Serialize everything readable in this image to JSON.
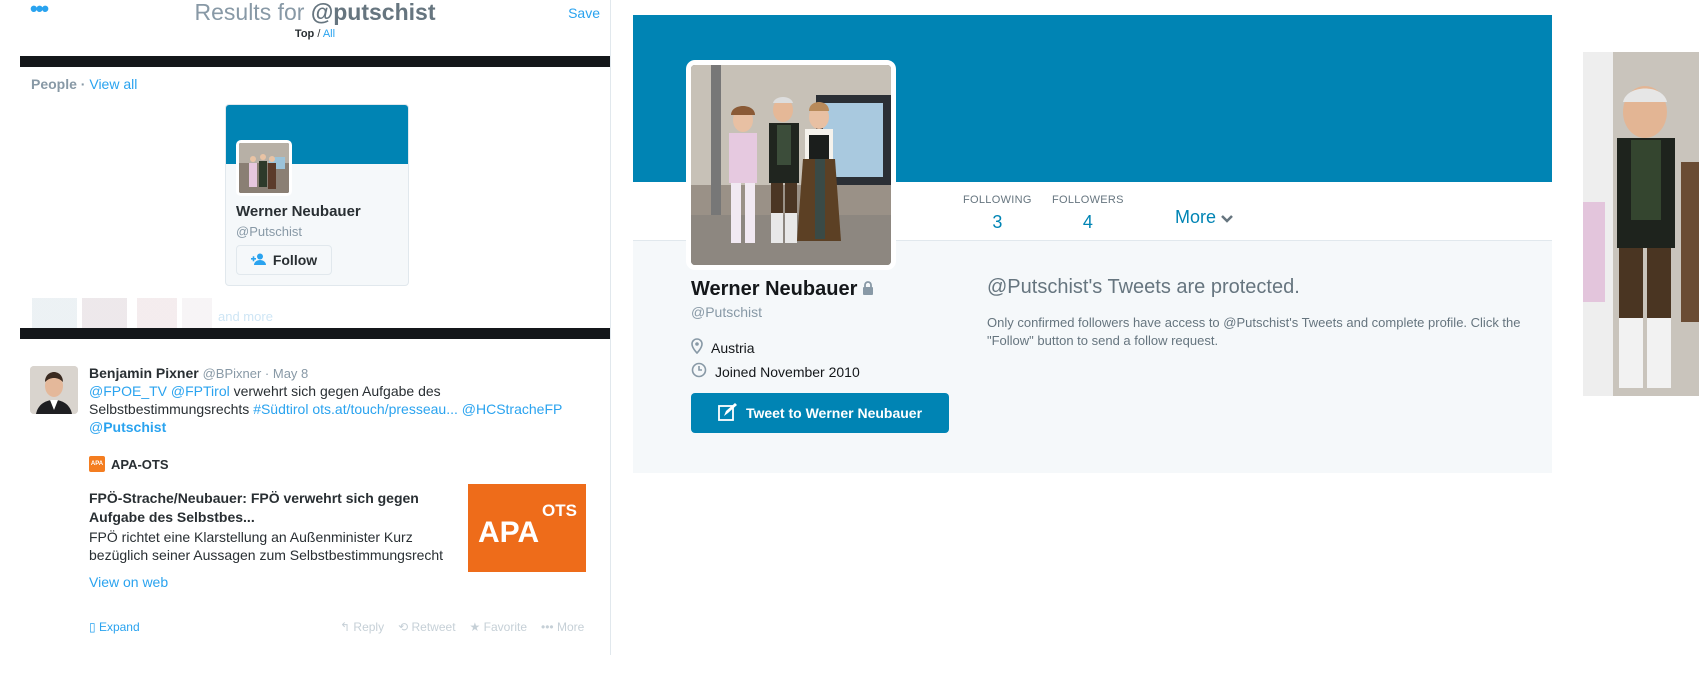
{
  "search": {
    "results_prefix": "Results for ",
    "query": "@putschist",
    "save_label": "Save",
    "filter_top": "Top",
    "filter_sep": " / ",
    "filter_all": "All",
    "menu_icon": "ellipsis-icon"
  },
  "people": {
    "label": "People",
    "sep": " · ",
    "view_all": "View all",
    "card": {
      "name": "Werner Neubauer",
      "handle": "@Putschist",
      "follow_label": "Follow"
    },
    "blurred_more": "and more"
  },
  "tweet": {
    "author_name": "Benjamin Pixner",
    "author_handle": "@BPixner",
    "date_sep": " · ",
    "date": "May 8",
    "mention1": "@FPOE_TV",
    "mention2": "@FPTirol",
    "text1": " verwehrt sich gegen Aufgabe des Selbstbestimmungsrechts ",
    "hashtag": "#Südtirol",
    "link": "ots.at/touch/presseau...",
    "mention3": "@HCStracheFP",
    "mention4_prefix": "@",
    "mention4_bold": "Putschist",
    "card": {
      "source": "APA-OTS",
      "title": "FPÖ-Strache/Neubauer: FPÖ verwehrt sich gegen Aufgabe des Selbstbes...",
      "description": "FPÖ richtet eine Klarstellung an Außenminister Kurz bezüglich seiner Aussagen zum Selbstbestimmungsrecht",
      "logo_text_main": "APA",
      "logo_text_sup": "OTS",
      "view_on_web": "View on web"
    },
    "expand": "Expand",
    "actions": [
      "Reply",
      "Retweet",
      "Favorite",
      "More"
    ]
  },
  "profile": {
    "following_label": "FOLLOWING",
    "following_count": "3",
    "followers_label": "FOLLOWERS",
    "followers_count": "4",
    "more_label": "More",
    "name": "Werner Neubauer",
    "handle": "@Putschist",
    "location": "Austria",
    "joined": "Joined November 2010",
    "tweet_to_label": "Tweet to Werner Neubauer",
    "protected_title": "@Putschist's Tweets are protected.",
    "protected_body": "Only confirmed followers have access to @Putschist's Tweets and complete profile. Click the \"Follow\" button to send a follow request."
  },
  "colors": {
    "brand_blue": "#0084b4",
    "link_blue": "#2aa3ef",
    "apa_orange": "#ee6c1a"
  }
}
